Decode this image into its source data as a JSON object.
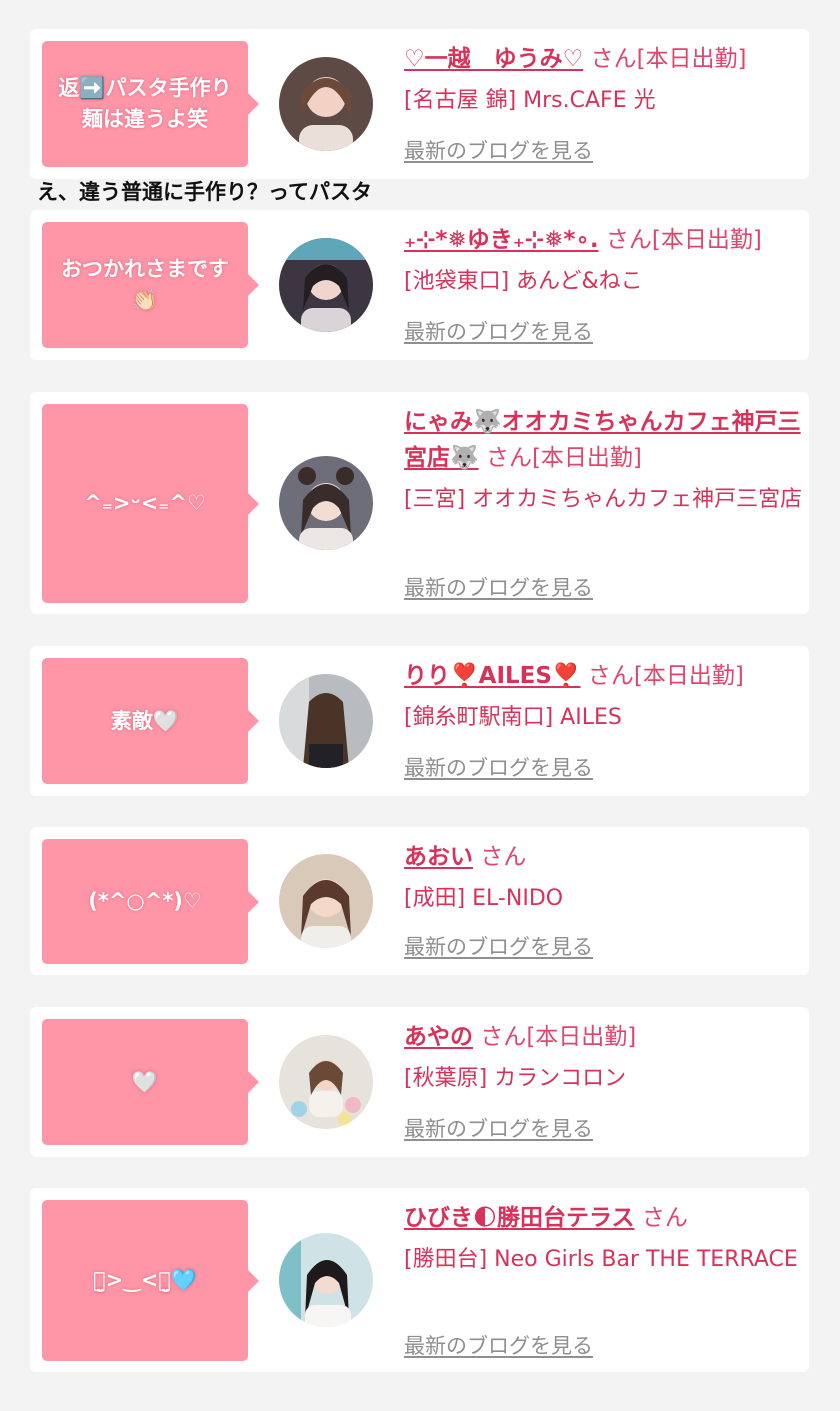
{
  "colors": {
    "accent": "#d9325a",
    "bubble": "#ff96a8",
    "link_gray": "#8f8f8f",
    "page_bg": "#f3f3f3"
  },
  "comment_text": "え、違う普通に手作り？ってパスタ",
  "blog_link": "最新のブログを見る",
  "entries": [
    {
      "bubble": "返➡️パスタ手作り 麺は違うよ笑",
      "name": "♡一越　ゆうみ♡",
      "san": "さん[本日出勤]",
      "shop": "[名古屋 錦] Mrs.CAFE 光",
      "avatar_icon": "profile-photo"
    },
    {
      "bubble": "おつかれさまです 👏🏻",
      "name": "₊⊹*❅︎ゆき₊⊹❅*∘.",
      "san": "さん[本日出勤]",
      "shop": "[池袋東口] あんど&ねこ",
      "avatar_icon": "profile-photo"
    },
    {
      "bubble": "^₌>ᵕ<₌^♡",
      "name": "にゃみ🐺オオカミちゃんカフェ神戸三宮店🐺",
      "san": "さん[本日出勤]",
      "shop": "[三宮] オオカミちゃんカフェ神戸三宮店",
      "avatar_icon": "profile-photo"
    },
    {
      "bubble": "素敵🤍",
      "name": "りり❣️AILES❣️",
      "san": "さん[本日出勤]",
      "shop": "[錦糸町駅南口] AILES",
      "avatar_icon": "profile-photo"
    },
    {
      "bubble": "(*^○^*)♡",
      "name": "あおい",
      "san": "さん",
      "shop": "[成田] EL-NIDO",
      "avatar_icon": "profile-photo"
    },
    {
      "bubble": "🤍",
      "name": "あやの",
      "san": "さん[本日出勤]",
      "shop": "[秋葉原] カランコロン",
      "avatar_icon": "profile-photo"
    },
    {
      "bubble": "ꪔ̤̮>‿<ꪔ̤̮🩵",
      "name": "ひびき🌓勝田台テラス",
      "san": "さん",
      "shop": "[勝田台] Neo Girls Bar THE TERRACE",
      "avatar_icon": "profile-photo"
    }
  ]
}
